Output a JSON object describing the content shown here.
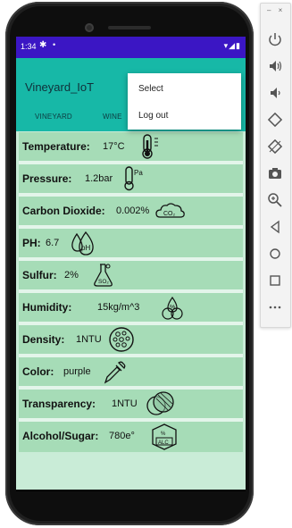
{
  "status_bar": {
    "time": "1:34",
    "gear": "✱",
    "dot": "•",
    "icons": "▾◢▮"
  },
  "app": {
    "title": "Vineyard_IoT"
  },
  "tabs": [
    {
      "label": "VINEYARD"
    },
    {
      "label": "WINE"
    }
  ],
  "menu": {
    "items": [
      {
        "label": "Select"
      },
      {
        "label": "Log out"
      }
    ]
  },
  "readings": [
    {
      "label": "Temperature:",
      "value": "17°C",
      "icon": "thermometer-icon"
    },
    {
      "label": "Pressure:",
      "value": "1.2bar",
      "icon": "pressure-gauge-icon"
    },
    {
      "label": "Carbon Dioxide:",
      "value": "0.002%",
      "icon": "co2-cloud-icon"
    },
    {
      "label": "PH:",
      "value": "6.7",
      "icon": "ph-drops-icon"
    },
    {
      "label": "Sulfur:",
      "value": "2%",
      "icon": "so2-flask-icon"
    },
    {
      "label": "Humidity:",
      "value": "15kg/m^3",
      "icon": "humidity-drops-icon"
    },
    {
      "label": "Density:",
      "value": "1NTU",
      "icon": "density-circle-icon"
    },
    {
      "label": "Color:",
      "value": "purple",
      "icon": "pipette-icon"
    },
    {
      "label": "Transparency:",
      "value": "1NTU",
      "icon": "transparency-circles-icon"
    },
    {
      "label": "Alcohol/Sugar:",
      "value": "780e°",
      "icon": "alcohol-badge-icon"
    }
  ],
  "icon_texts": {
    "pressure": "Pa",
    "co2": "CO₂",
    "ph": "pH",
    "so2": "SO₂",
    "humidity": "%",
    "alc": "ALC",
    "pct": "%"
  },
  "panel": {
    "top": "– ×"
  },
  "colors": {
    "status_bar": "#3b16c4",
    "app_bar": "#17b8a7",
    "row": "#a6dcb7",
    "background": "#c9ecd7"
  }
}
